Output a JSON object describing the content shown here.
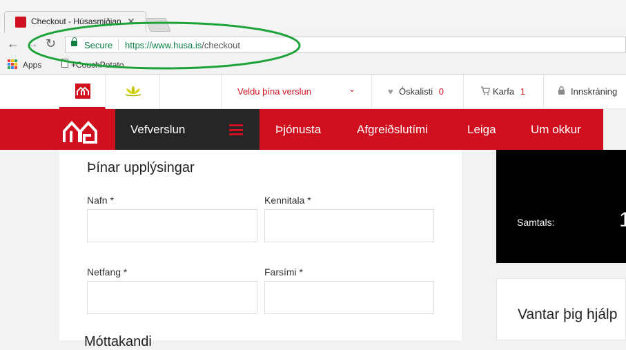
{
  "browser": {
    "tab_title": "Checkout - Húsasmiðjan",
    "secure_label": "Secure",
    "url_host": "https://www.husa.is",
    "url_path": "/checkout",
    "bookmarks": [
      "Apps",
      "+CouchPotato"
    ]
  },
  "header": {
    "store_select": "Veldu þína verslun",
    "wishlist_label": "Óskalisti",
    "wishlist_count": "0",
    "cart_label": "Karfa",
    "cart_count": "1",
    "login_label": "Innskráning"
  },
  "nav": {
    "items": [
      "Vefverslun",
      "Þjónusta",
      "Afgreiðslutími",
      "Leiga",
      "Um okkur"
    ]
  },
  "form": {
    "section_title": "Þínar upplýsingar",
    "fields": [
      {
        "label": "Nafn *",
        "value": ""
      },
      {
        "label": "Kennitala *",
        "value": ""
      },
      {
        "label": "Netfang *",
        "value": ""
      },
      {
        "label": "Farsími *",
        "value": ""
      }
    ],
    "next_section_partial": "Móttakandi"
  },
  "summary": {
    "total_label": "Samtals:",
    "total_value_partial": "1",
    "help_title": "Vantar þig hjálp"
  },
  "colors": {
    "brand_red": "#d0101e",
    "dark": "#262626",
    "annotation_green": "#1fa23a"
  }
}
